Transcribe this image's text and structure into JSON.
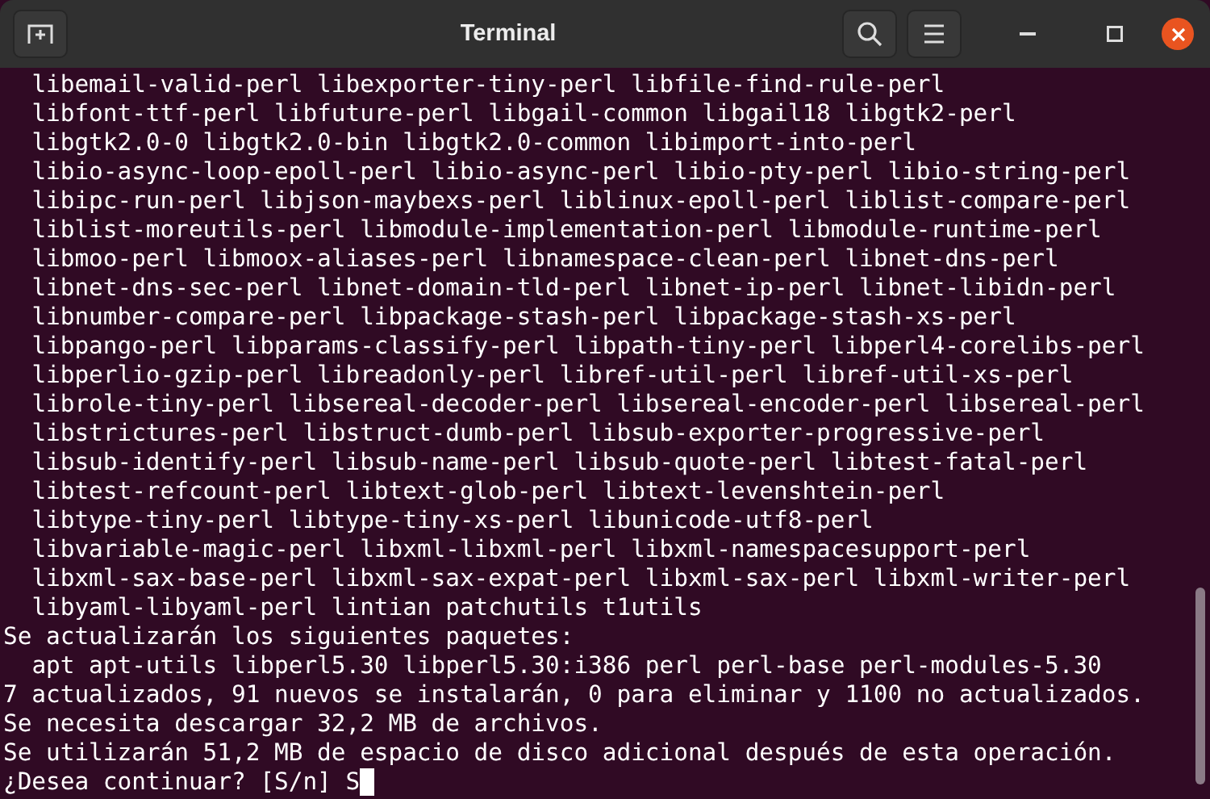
{
  "window": {
    "title": "Terminal"
  },
  "lines": [
    {
      "text": "libemail-valid-perl libexporter-tiny-perl libfile-find-rule-perl",
      "indented": true
    },
    {
      "text": "libfont-ttf-perl libfuture-perl libgail-common libgail18 libgtk2-perl",
      "indented": true
    },
    {
      "text": "libgtk2.0-0 libgtk2.0-bin libgtk2.0-common libimport-into-perl",
      "indented": true
    },
    {
      "text": "libio-async-loop-epoll-perl libio-async-perl libio-pty-perl libio-string-perl",
      "indented": true
    },
    {
      "text": "libipc-run-perl libjson-maybexs-perl liblinux-epoll-perl liblist-compare-perl",
      "indented": true
    },
    {
      "text": "liblist-moreutils-perl libmodule-implementation-perl libmodule-runtime-perl",
      "indented": true
    },
    {
      "text": "libmoo-perl libmoox-aliases-perl libnamespace-clean-perl libnet-dns-perl",
      "indented": true
    },
    {
      "text": "libnet-dns-sec-perl libnet-domain-tld-perl libnet-ip-perl libnet-libidn-perl",
      "indented": true
    },
    {
      "text": "libnumber-compare-perl libpackage-stash-perl libpackage-stash-xs-perl",
      "indented": true
    },
    {
      "text": "libpango-perl libparams-classify-perl libpath-tiny-perl libperl4-corelibs-perl",
      "indented": true
    },
    {
      "text": "libperlio-gzip-perl libreadonly-perl libref-util-perl libref-util-xs-perl",
      "indented": true
    },
    {
      "text": "librole-tiny-perl libsereal-decoder-perl libsereal-encoder-perl libsereal-perl",
      "indented": true
    },
    {
      "text": "libstrictures-perl libstruct-dumb-perl libsub-exporter-progressive-perl",
      "indented": true
    },
    {
      "text": "libsub-identify-perl libsub-name-perl libsub-quote-perl libtest-fatal-perl",
      "indented": true
    },
    {
      "text": "libtest-refcount-perl libtext-glob-perl libtext-levenshtein-perl",
      "indented": true
    },
    {
      "text": "libtype-tiny-perl libtype-tiny-xs-perl libunicode-utf8-perl",
      "indented": true
    },
    {
      "text": "libvariable-magic-perl libxml-libxml-perl libxml-namespacesupport-perl",
      "indented": true
    },
    {
      "text": "libxml-sax-base-perl libxml-sax-expat-perl libxml-sax-perl libxml-writer-perl",
      "indented": true
    },
    {
      "text": "libyaml-libyaml-perl lintian patchutils t1utils",
      "indented": true
    },
    {
      "text": "Se actualizarán los siguientes paquetes:",
      "indented": false
    },
    {
      "text": "apt apt-utils libperl5.30 libperl5.30:i386 perl perl-base perl-modules-5.30",
      "indented": true
    },
    {
      "text": "7 actualizados, 91 nuevos se instalarán, 0 para eliminar y 1100 no actualizados.",
      "indented": false
    },
    {
      "text": "Se necesita descargar 32,2 MB de archivos.",
      "indented": false
    },
    {
      "text": "Se utilizarán 51,2 MB de espacio de disco adicional después de esta operación.",
      "indented": false
    }
  ],
  "prompt": {
    "text": "¿Desea continuar? [S/n]",
    "input": "S"
  }
}
